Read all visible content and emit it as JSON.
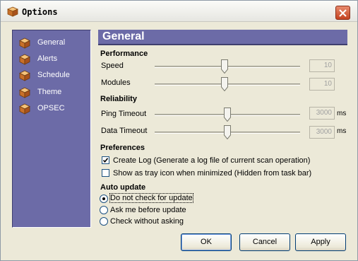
{
  "window": {
    "title": "Options"
  },
  "sidebar": {
    "items": [
      {
        "label": "General",
        "icon": "cube-icon"
      },
      {
        "label": "Alerts",
        "icon": "cube-icon"
      },
      {
        "label": "Schedule",
        "icon": "cube-icon"
      },
      {
        "label": "Theme",
        "icon": "cube-icon"
      },
      {
        "label": "OPSEC",
        "icon": "cube-icon"
      }
    ],
    "selected": "General"
  },
  "panel": {
    "title": "General",
    "performance": {
      "heading": "Performance",
      "speed": {
        "label": "Speed",
        "value": "10",
        "level": 0.48
      },
      "modules": {
        "label": "Modules",
        "value": "10",
        "level": 0.48
      }
    },
    "reliability": {
      "heading": "Reliability",
      "ping_timeout": {
        "label": "Ping Timeout",
        "value": "3000",
        "unit": "ms",
        "level": 0.5
      },
      "data_timeout": {
        "label": "Data Timeout",
        "value": "3000",
        "unit": "ms",
        "level": 0.5
      }
    },
    "preferences": {
      "heading": "Preferences",
      "create_log": {
        "label": "Create Log  (Generate a log file of current scan operation)",
        "checked": true
      },
      "tray_icon": {
        "label": "Show as tray icon when minimized (Hidden from task bar)",
        "checked": false
      }
    },
    "auto_update": {
      "heading": "Auto update",
      "options": [
        {
          "label": "Do not check for update",
          "selected": true
        },
        {
          "label": "Ask me before update",
          "selected": false
        },
        {
          "label": "Check without asking",
          "selected": false
        }
      ]
    }
  },
  "buttons": {
    "ok": "OK",
    "cancel": "Cancel",
    "apply": "Apply"
  },
  "colors": {
    "panel_accent": "#6c6ba7",
    "window_bg": "#ece9d8",
    "close_red": "#c44220"
  }
}
